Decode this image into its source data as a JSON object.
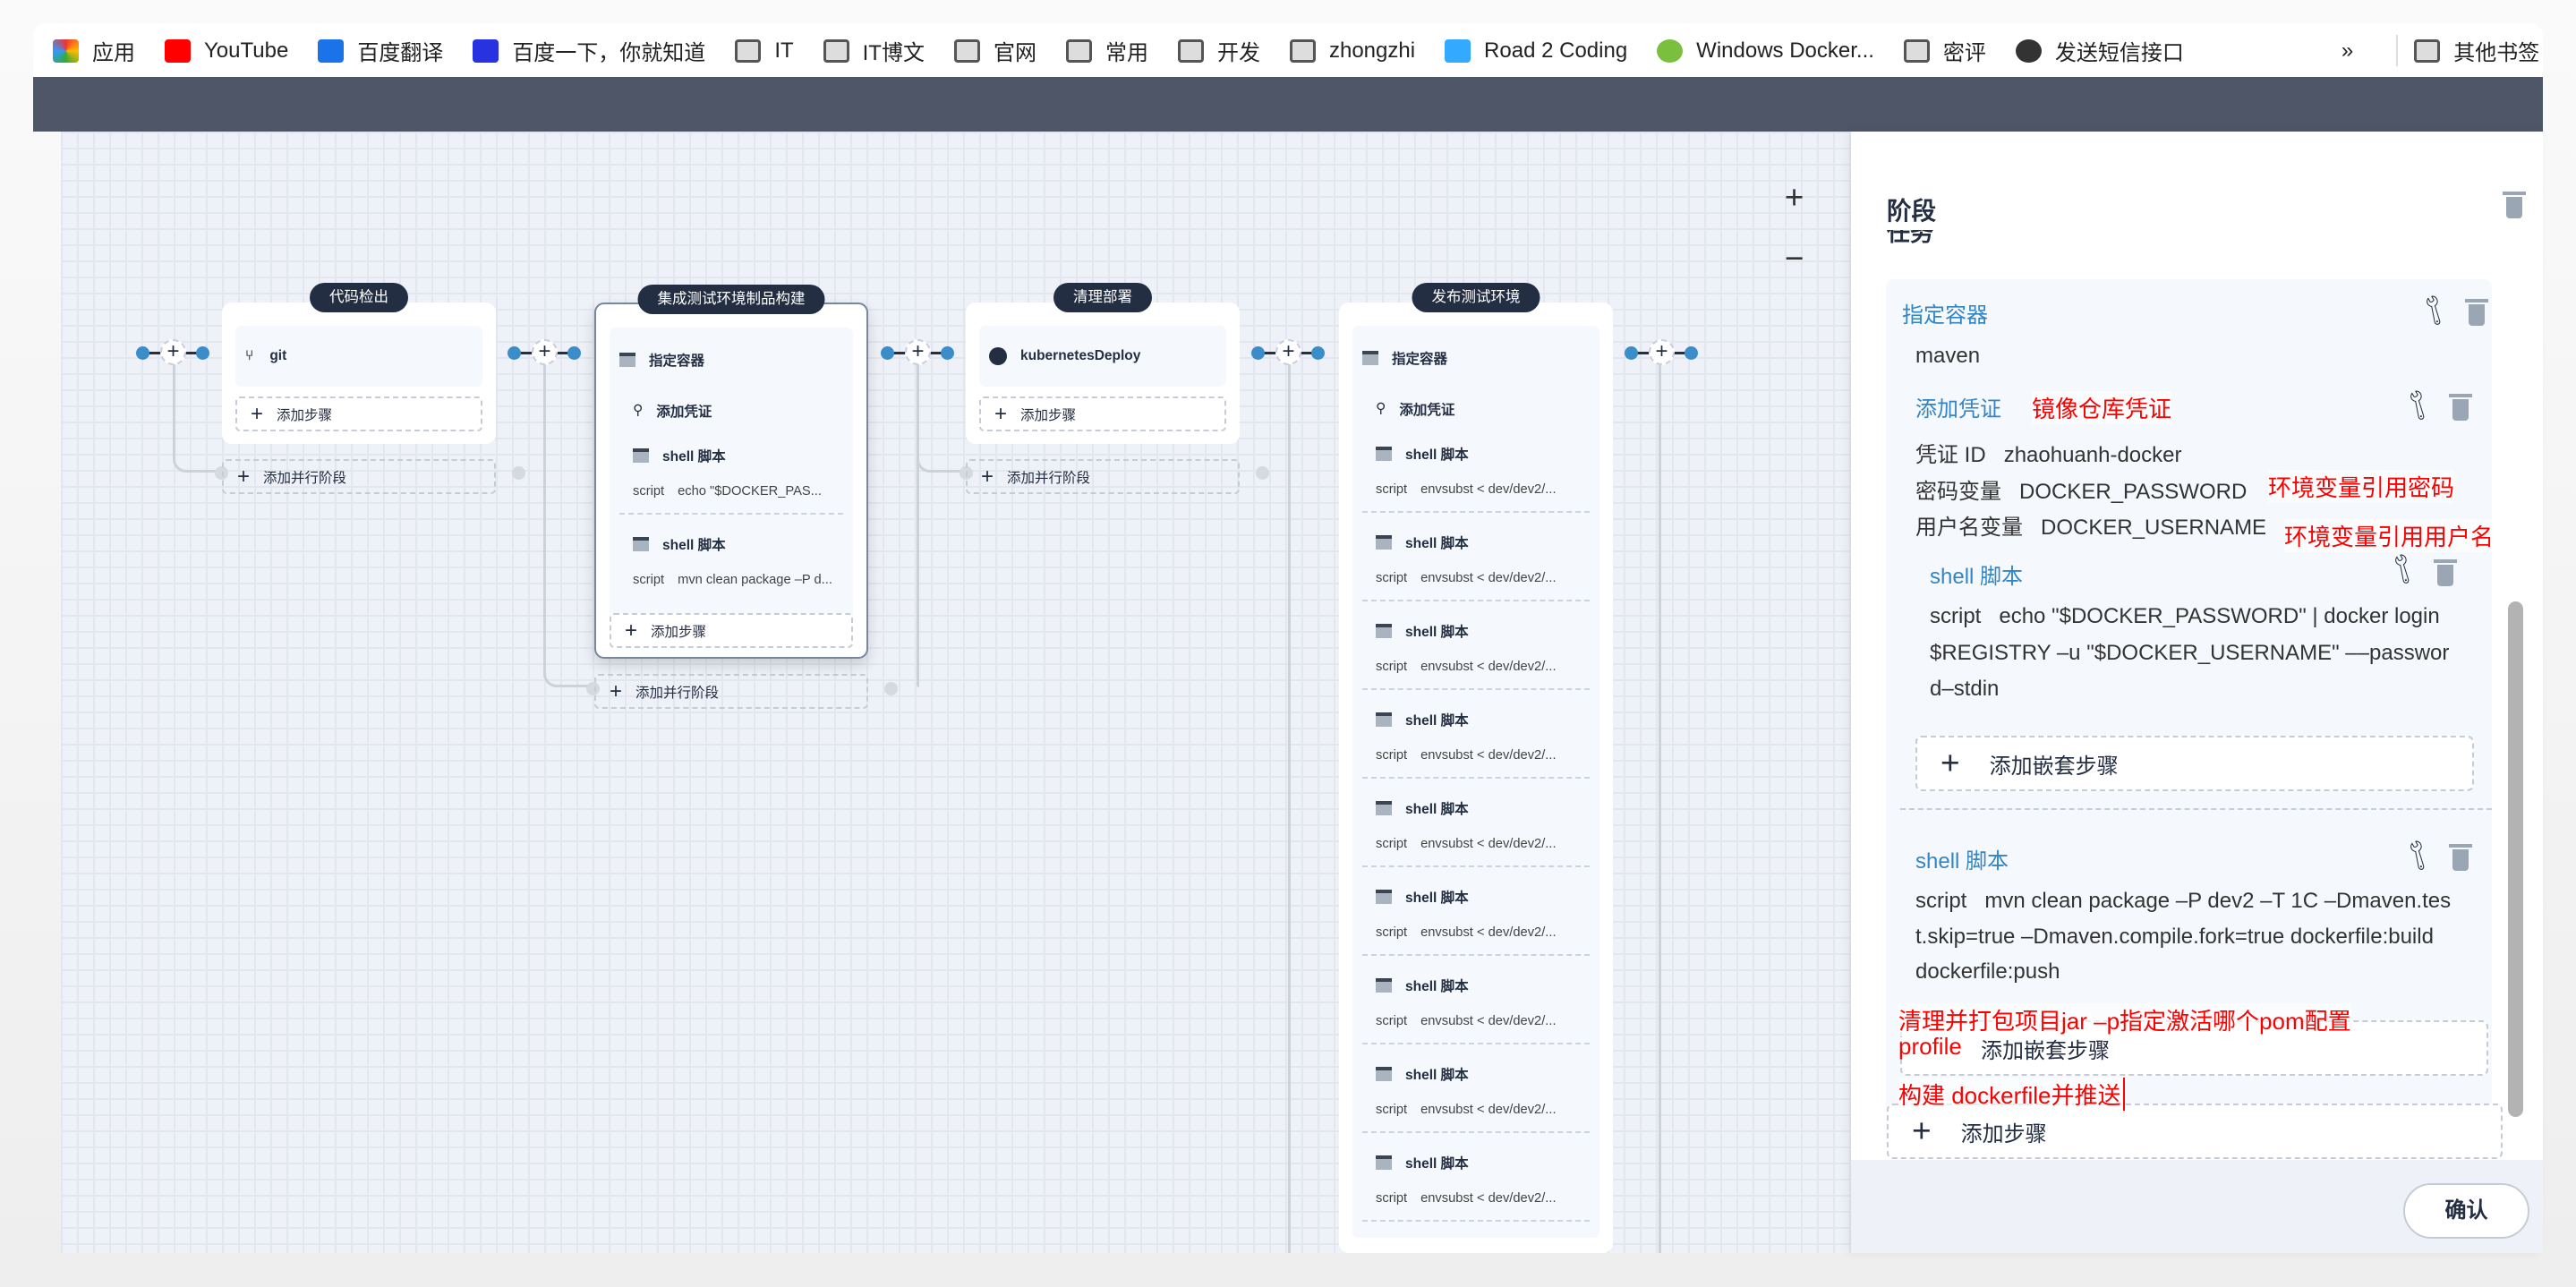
{
  "bookmarks": [
    {
      "label": "应用",
      "icon": "apps-grid-icon"
    },
    {
      "label": "YouTube",
      "icon": "youtube-icon"
    },
    {
      "label": "百度翻译",
      "icon": "baidu-translate-icon"
    },
    {
      "label": "百度一下，你就知道",
      "icon": "baidu-paw-icon"
    },
    {
      "label": "IT",
      "icon": "folder-icon"
    },
    {
      "label": "IT博文",
      "icon": "folder-icon"
    },
    {
      "label": "官网",
      "icon": "folder-icon"
    },
    {
      "label": "常用",
      "icon": "folder-icon"
    },
    {
      "label": "开发",
      "icon": "folder-icon"
    },
    {
      "label": "zhongzhi",
      "icon": "folder-icon"
    },
    {
      "label": "Road 2 Coding",
      "icon": "footprint-icon"
    },
    {
      "label": "Windows Docker...",
      "icon": "docker-doc-icon"
    },
    {
      "label": "密评",
      "icon": "folder-icon"
    },
    {
      "label": "发送短信接口",
      "icon": "globe-icon"
    }
  ],
  "bookmarks_more": "»",
  "bookmarks_other": "其他书签",
  "canvas": {
    "zoom_in": "+",
    "zoom_out": "−",
    "add_step": "添加步骤",
    "add_parallel": "添加并行阶段",
    "connector_plus": "+"
  },
  "stages": [
    {
      "name": "代码检出",
      "steps": [
        {
          "type": "git",
          "title": "git"
        }
      ]
    },
    {
      "name": "集成测试环境制品构建",
      "steps": [
        {
          "type": "container",
          "title": "指定容器"
        },
        {
          "type": "cred",
          "title": "添加凭证"
        },
        {
          "type": "shell",
          "title": "shell 脚本",
          "script_label": "script",
          "script": "echo \"$DOCKER_PAS..."
        },
        {
          "type": "shell",
          "title": "shell 脚本",
          "script_label": "script",
          "script": "mvn clean package –P d..."
        }
      ]
    },
    {
      "name": "清理部署",
      "steps": [
        {
          "type": "k8s",
          "title": "kubernetesDeploy"
        }
      ]
    },
    {
      "name": "发布测试环境",
      "steps": [
        {
          "type": "container",
          "title": "指定容器"
        },
        {
          "type": "cred",
          "title": "添加凭证"
        },
        {
          "type": "shell",
          "title": "shell 脚本",
          "script_label": "script",
          "script": "envsubst < dev/dev2/..."
        },
        {
          "type": "shell",
          "title": "shell 脚本",
          "script_label": "script",
          "script": "envsubst < dev/dev2/..."
        },
        {
          "type": "shell",
          "title": "shell 脚本",
          "script_label": "script",
          "script": "envsubst < dev/dev2/..."
        },
        {
          "type": "shell",
          "title": "shell 脚本",
          "script_label": "script",
          "script": "envsubst < dev/dev2/..."
        },
        {
          "type": "shell",
          "title": "shell 脚本",
          "script_label": "script",
          "script": "envsubst < dev/dev2/..."
        },
        {
          "type": "shell",
          "title": "shell 脚本",
          "script_label": "script",
          "script": "envsubst < dev/dev2/..."
        },
        {
          "type": "shell",
          "title": "shell 脚本",
          "script_label": "script",
          "script": "envsubst < dev/dev2/..."
        },
        {
          "type": "shell",
          "title": "shell 脚本",
          "script_label": "script",
          "script": "envsubst < dev/dev2/..."
        },
        {
          "type": "shell",
          "title": "shell 脚本",
          "script_label": "script",
          "script": "envsubst < dev/dev2/..."
        }
      ]
    }
  ],
  "panel": {
    "title": "阶段",
    "section_partial": "任务",
    "container": {
      "title": "指定容器",
      "value": "maven"
    },
    "cred": {
      "title": "添加凭证",
      "id_label": "凭证 ID",
      "id": "zhaohuanh-docker",
      "pwd_label": "密码变量",
      "pwd": "DOCKER_PASSWORD",
      "user_label": "用户名变量",
      "user": "DOCKER_USERNAME"
    },
    "shell1": {
      "title": "shell 脚本",
      "script_label": "script",
      "lines": [
        "echo \"$DOCKER_PASSWORD\" | docker login",
        "$REGISTRY –u \"$DOCKER_USERNAME\" ––passwor",
        "d–stdin"
      ]
    },
    "add_nested": "添加嵌套步骤",
    "shell2": {
      "title": "shell 脚本",
      "script_label": "script",
      "lines": [
        "mvn clean package –P dev2 –T 1C –Dmaven.tes",
        "t.skip=true –Dmaven.compile.fork=true dockerfile:build",
        "dockerfile:push"
      ]
    },
    "add_step": "添加步骤",
    "confirm": "确认",
    "annotations": {
      "cred": "镜像仓库凭证",
      "pwd": "环境变量引用密码",
      "user": "环境变量引用用户名",
      "mvn1": "清理并打包项目jar –p指定激活哪个pom配置",
      "mvn2": "profile",
      "mvn3": "构建 dockerfile并推送"
    },
    "annotation_color": "#ff0000",
    "accent": "#3385c6"
  }
}
